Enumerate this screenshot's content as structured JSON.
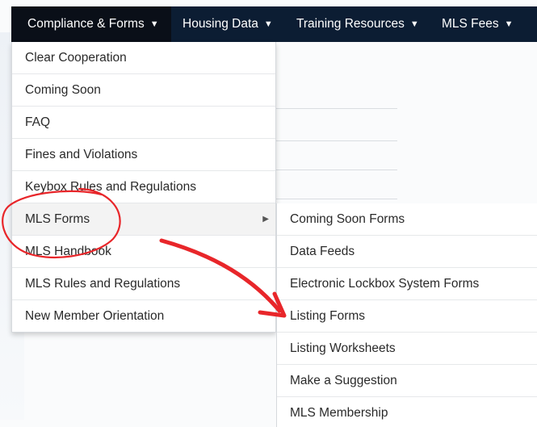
{
  "nav": {
    "items": [
      {
        "label": "Compliance & Forms",
        "caret": "▼"
      },
      {
        "label": "Housing Data",
        "caret": "▼"
      },
      {
        "label": "Training Resources",
        "caret": "▼"
      },
      {
        "label": "MLS Fees",
        "caret": "▼"
      }
    ]
  },
  "dropdown": {
    "items": [
      {
        "label": "Clear Cooperation"
      },
      {
        "label": "Coming Soon"
      },
      {
        "label": "FAQ"
      },
      {
        "label": "Fines and Violations"
      },
      {
        "label": "Keybox Rules and Regulations"
      },
      {
        "label": "MLS Forms",
        "submenu_arrow": "▶"
      },
      {
        "label": "MLS Handbook"
      },
      {
        "label": "MLS Rules and Regulations"
      },
      {
        "label": "New Member Orientation"
      }
    ]
  },
  "submenu": {
    "items": [
      {
        "label": "Coming Soon Forms"
      },
      {
        "label": "Data Feeds"
      },
      {
        "label": "Electronic Lockbox System Forms"
      },
      {
        "label": "Listing Forms"
      },
      {
        "label": "Listing Worksheets"
      },
      {
        "label": "Make a Suggestion"
      },
      {
        "label": "MLS Membership"
      }
    ]
  },
  "colors": {
    "navbar_bg": "#0c1d33",
    "active_nav_bg": "#0a0f18",
    "annotation_red": "#e8262a"
  }
}
